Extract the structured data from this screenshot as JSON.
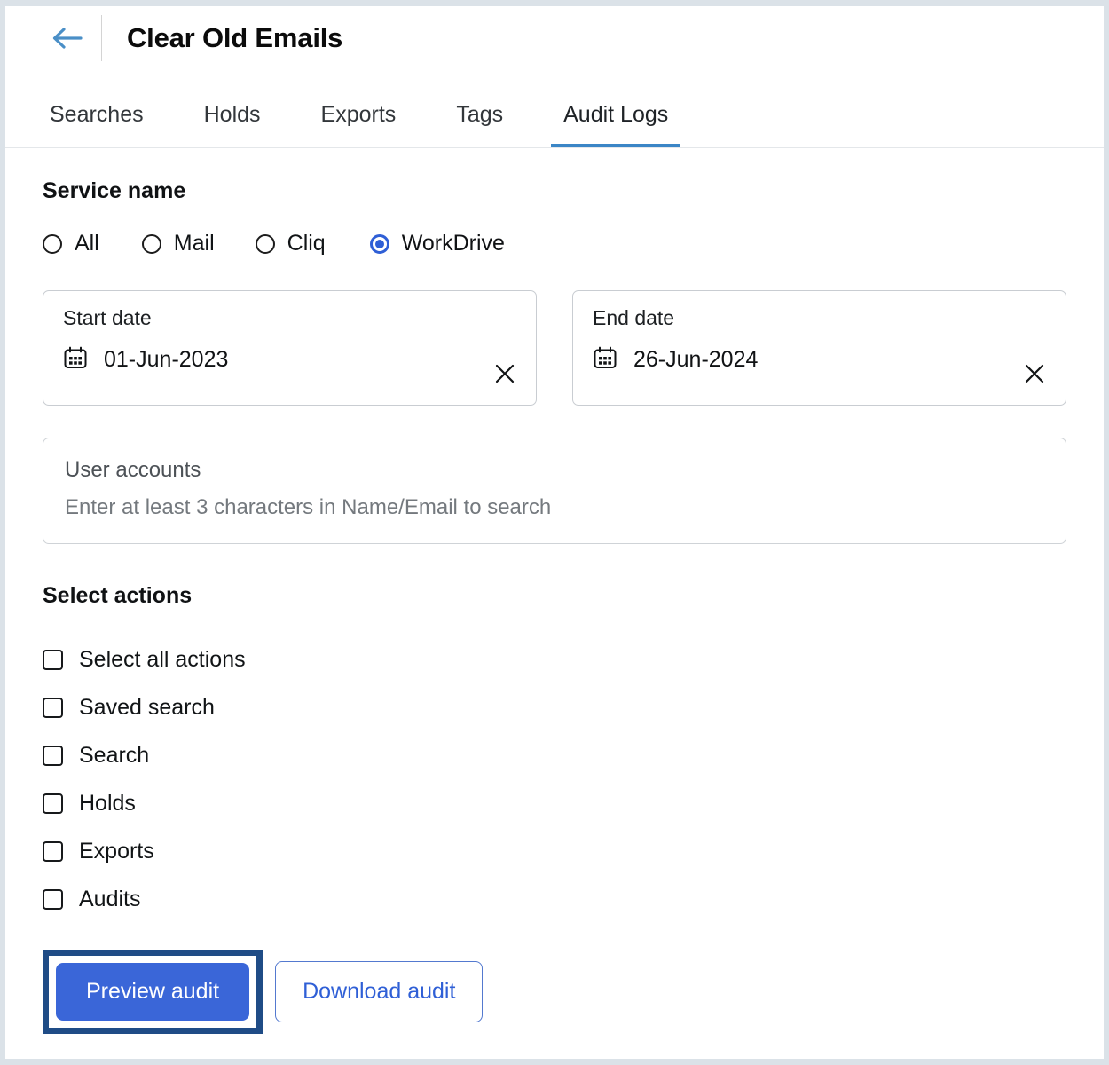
{
  "header": {
    "back_icon": "back-arrow-icon",
    "title": "Clear Old Emails"
  },
  "tabs": [
    {
      "label": "Searches",
      "active": false
    },
    {
      "label": "Holds",
      "active": false
    },
    {
      "label": "Exports",
      "active": false
    },
    {
      "label": "Tags",
      "active": false
    },
    {
      "label": "Audit Logs",
      "active": true
    }
  ],
  "service_name": {
    "heading": "Service name",
    "options": [
      {
        "label": "All",
        "selected": false
      },
      {
        "label": "Mail",
        "selected": false
      },
      {
        "label": "Cliq",
        "selected": false
      },
      {
        "label": "WorkDrive",
        "selected": true
      }
    ]
  },
  "start_date": {
    "label": "Start date",
    "value": "01-Jun-2023",
    "calendar_icon": "calendar-icon",
    "clear_icon": "close-icon"
  },
  "end_date": {
    "label": "End date",
    "value": "26-Jun-2024",
    "calendar_icon": "calendar-icon",
    "clear_icon": "close-icon"
  },
  "user_accounts": {
    "label": "User accounts",
    "placeholder": "Enter at least 3 characters in Name/Email to search",
    "value": ""
  },
  "select_actions": {
    "heading": "Select actions",
    "items": [
      {
        "label": "Select all actions",
        "checked": false
      },
      {
        "label": "Saved search",
        "checked": false
      },
      {
        "label": "Search",
        "checked": false
      },
      {
        "label": "Holds",
        "checked": false
      },
      {
        "label": "Exports",
        "checked": false
      },
      {
        "label": "Audits",
        "checked": false
      }
    ]
  },
  "footer": {
    "preview_label": "Preview audit",
    "download_label": "Download audit"
  },
  "colors": {
    "accent_blue": "#3a66d8",
    "tab_underline": "#3b86c6",
    "back_arrow": "#4a8fc7",
    "highlight_border": "#1f4c86",
    "page_border": "#dbe2e8",
    "link_blue": "#2f5fd6"
  }
}
